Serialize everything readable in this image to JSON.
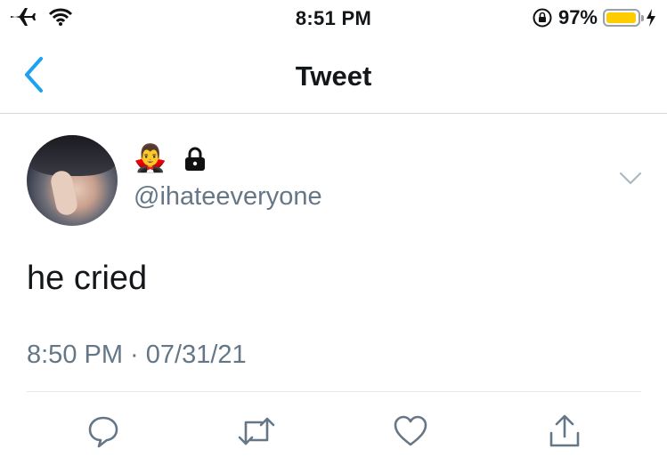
{
  "status_bar": {
    "time": "8:51 PM",
    "battery_percent": "97%",
    "battery_level": 0.97,
    "battery_color": "#ffcc00"
  },
  "nav": {
    "title": "Tweet",
    "back_icon": "chevron-left-icon",
    "accent_color": "#1da1f2"
  },
  "tweet": {
    "display_name_emoji": "🧛‍♂️",
    "handle": "@ihateeveryone",
    "text": "he cried",
    "timestamp": "8:50 PM · 07/31/21"
  },
  "actions": [
    "reply-icon",
    "retweet-icon",
    "like-icon",
    "share-icon"
  ]
}
